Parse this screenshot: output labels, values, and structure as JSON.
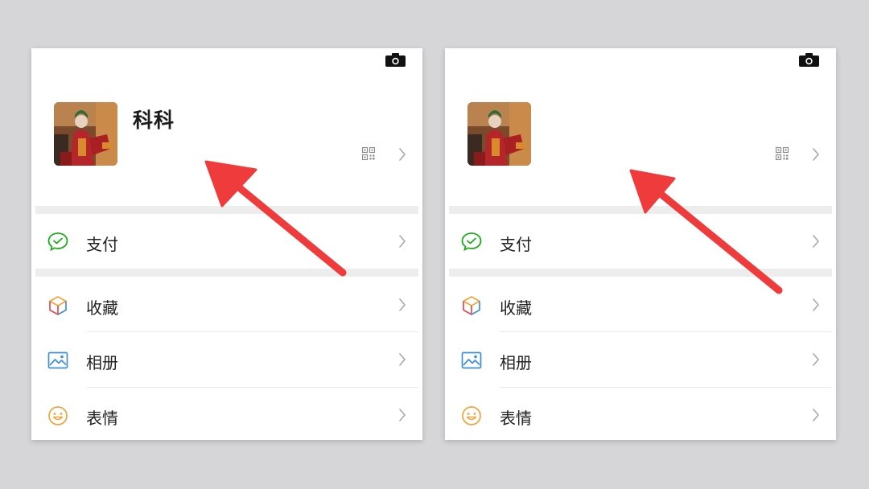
{
  "panels": [
    {
      "id": "left",
      "nickname": "科科",
      "menu": [
        {
          "label": "支付"
        },
        {
          "label": "收藏"
        },
        {
          "label": "相册"
        },
        {
          "label": "表情"
        }
      ]
    },
    {
      "id": "right",
      "nickname": "",
      "menu": [
        {
          "label": "支付"
        },
        {
          "label": "收藏"
        },
        {
          "label": "相册"
        },
        {
          "label": "表情"
        }
      ]
    }
  ],
  "colors": {
    "background": "#d6d6d8",
    "arrow": "#ef3b3b",
    "pay_green": "#1aad19",
    "album_blue": "#3d8fd6",
    "sticker_orange": "#f2a33a"
  },
  "icons": [
    "camera-icon",
    "qr-code-icon",
    "chevron-right-icon",
    "wechat-pay-icon",
    "favorites-cube-icon",
    "album-image-icon",
    "smiley-icon"
  ]
}
